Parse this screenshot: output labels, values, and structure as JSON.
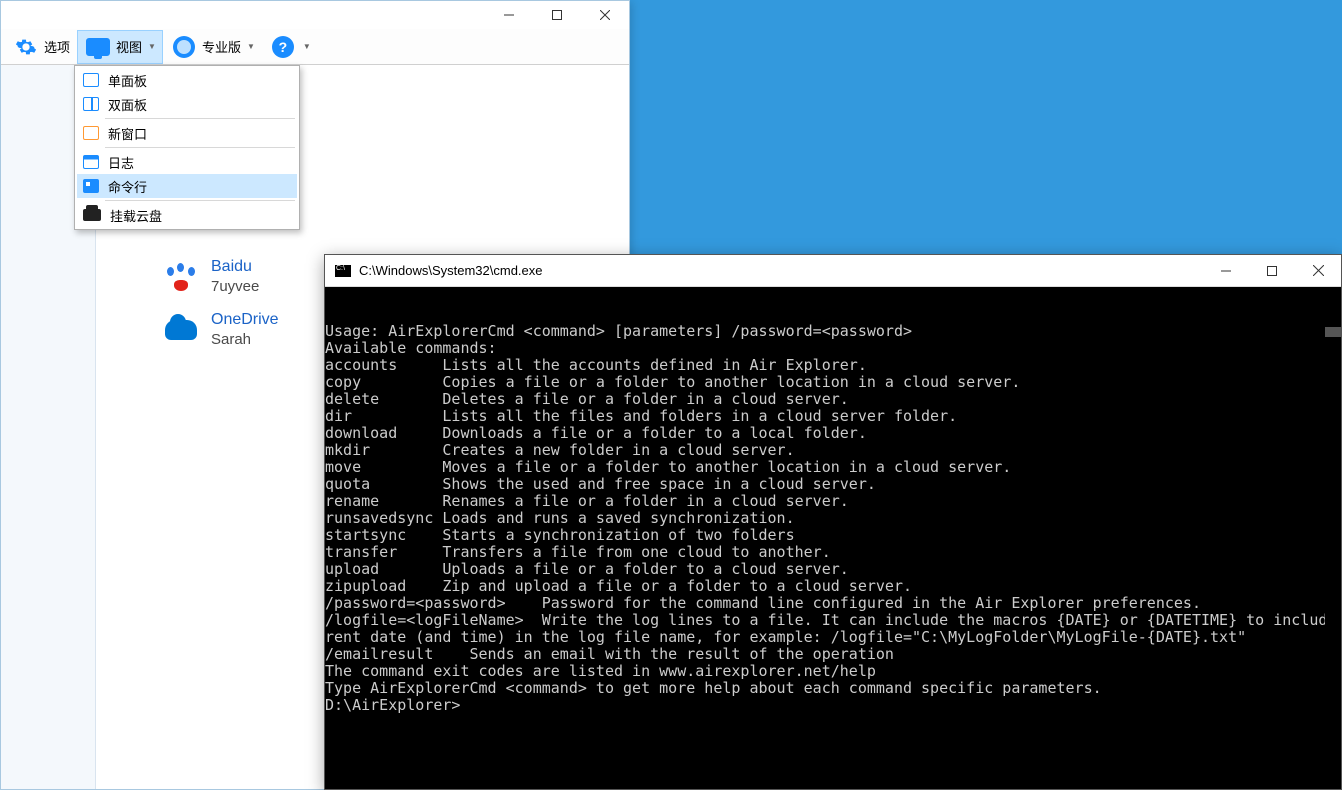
{
  "toolbar": {
    "options": "选项",
    "view": "视图",
    "pro": "专业版",
    "help": "?"
  },
  "view_menu": {
    "items": [
      {
        "label": "单面板",
        "ico": "single"
      },
      {
        "label": "双面板",
        "ico": "dual"
      },
      {
        "label": "新窗口",
        "ico": "newwin",
        "sep_before": true
      },
      {
        "label": "日志",
        "ico": "log",
        "sep_before": true
      },
      {
        "label": "命令行",
        "ico": "cmd",
        "hover": true
      },
      {
        "label": "挂载云盘",
        "ico": "mount",
        "sep_before": true
      }
    ]
  },
  "accounts": [
    {
      "service": "Baidu",
      "user": "7uyvee",
      "icon": "baidu"
    },
    {
      "service": "OneDrive",
      "user": "Sarah",
      "icon": "onedrive"
    }
  ],
  "cmd": {
    "title": "C:\\Windows\\System32\\cmd.exe",
    "lines": [
      "Usage: AirExplorerCmd <command> [parameters] /password=<password>",
      "",
      "Available commands:",
      "accounts     Lists all the accounts defined in Air Explorer.",
      "copy         Copies a file or a folder to another location in a cloud server.",
      "delete       Deletes a file or a folder in a cloud server.",
      "dir          Lists all the files and folders in a cloud server folder.",
      "download     Downloads a file or a folder to a local folder.",
      "mkdir        Creates a new folder in a cloud server.",
      "move         Moves a file or a folder to another location in a cloud server.",
      "quota        Shows the used and free space in a cloud server.",
      "rename       Renames a file or a folder in a cloud server.",
      "runsavedsync Loads and runs a saved synchronization.",
      "startsync    Starts a synchronization of two folders",
      "transfer     Transfers a file from one cloud to another.",
      "upload       Uploads a file or a folder to a cloud server.",
      "zipupload    Zip and upload a file or a folder to a cloud server.",
      "",
      "/password=<password>    Password for the command line configured in the Air Explorer preferences.",
      "",
      "/logfile=<logFileName>  Write the log lines to a file. It can include the macros {DATE} or {DATETIME} to include the cur",
      "rent date (and time) in the log file name, for example: /logfile=\"C:\\MyLogFolder\\MyLogFile-{DATE}.txt\"",
      "",
      "/emailresult    Sends an email with the result of the operation",
      "",
      "The command exit codes are listed in www.airexplorer.net/help",
      "",
      "Type AirExplorerCmd <command> to get more help about each command specific parameters.",
      "",
      "D:\\AirExplorer>"
    ]
  }
}
